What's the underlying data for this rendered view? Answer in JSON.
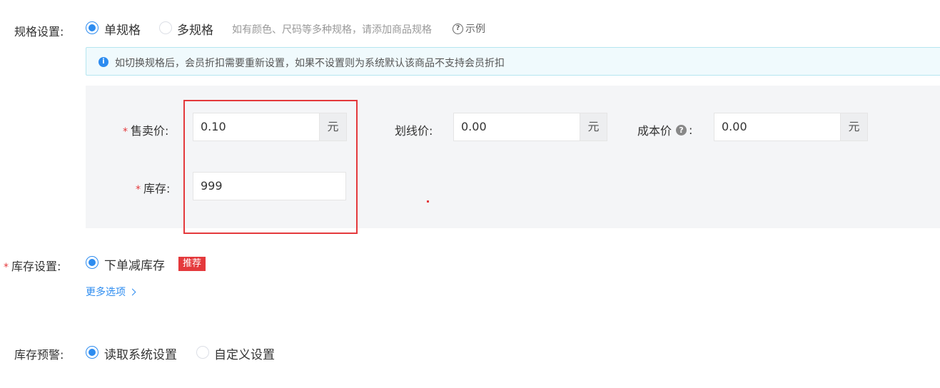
{
  "spec": {
    "label": "规格设置:",
    "options": [
      {
        "label": "单规格",
        "selected": true
      },
      {
        "label": "多规格",
        "selected": false
      }
    ],
    "hint": "如有颜色、尺码等多种规格，请添加商品规格",
    "example_link": "示例",
    "notice": "如切换规格后，会员折扣需要重新设置，如果不设置则为系统默认该商品不支持会员折扣"
  },
  "pricing": {
    "sale_price": {
      "required_mark": "*",
      "label": "售卖价:",
      "value": "0.10",
      "unit": "元"
    },
    "strike_price": {
      "label": "划线价:",
      "value": "0.00",
      "unit": "元"
    },
    "cost_price": {
      "label_prefix": "成本价",
      "label_suffix": ":",
      "value": "0.00",
      "unit": "元"
    },
    "stock": {
      "required_mark": "*",
      "label": "库存:",
      "value": "999"
    }
  },
  "stock_setting": {
    "required_mark": "*",
    "label": "库存设置:",
    "option": "下单减库存",
    "selected": true,
    "tag": "推荐",
    "more_options": "更多选项"
  },
  "stock_warning": {
    "label": "库存预警:",
    "options": [
      {
        "label": "读取系统设置",
        "selected": true
      },
      {
        "label": "自定义设置",
        "selected": false
      }
    ]
  },
  "colors": {
    "accent": "#2d8cf0",
    "required": "#e4393c",
    "panel_bg": "#f4f5f7",
    "notice_bg": "#f0fafd"
  }
}
